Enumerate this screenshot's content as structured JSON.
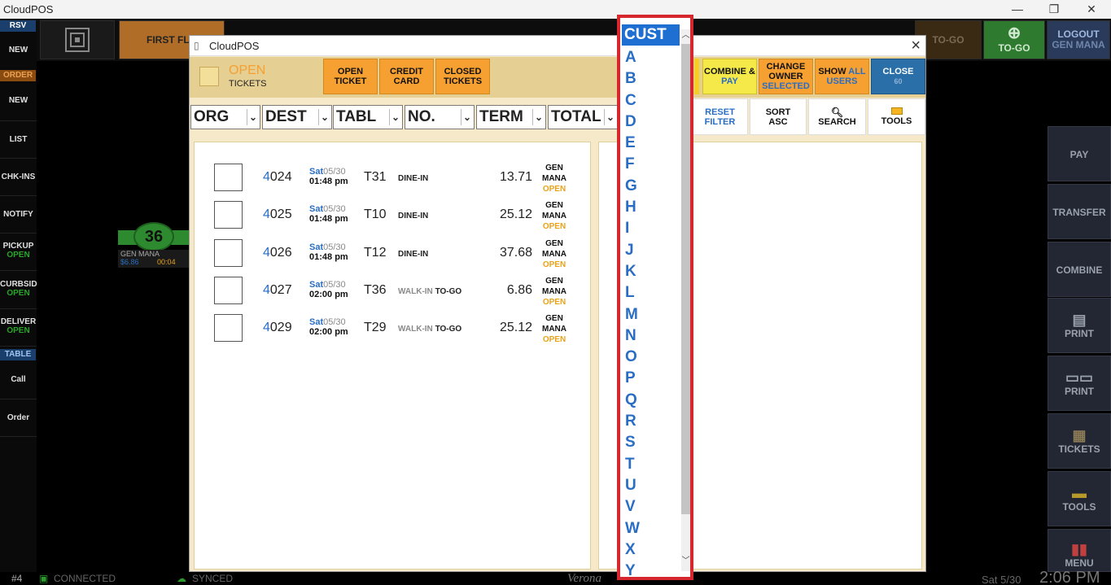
{
  "window": {
    "title": "CloudPOS",
    "min": "—",
    "restore": "❐",
    "close": "✕"
  },
  "leftbar": {
    "sec_rsv": "RSV",
    "new1": "NEW",
    "sec_order": "ORDER",
    "new2": "NEW",
    "list": "LIST",
    "chkins": "CHK-INS",
    "notify": "NOTIFY",
    "pickup": "PICKUP",
    "pickup_status": "OPEN",
    "curbside": "CURBSID",
    "curbside_status": "OPEN",
    "delivery": "DELIVER",
    "delivery_status": "OPEN",
    "sec_table": "TABLE",
    "call": "Call",
    "order": "Order"
  },
  "topbar": {
    "floor": "FIRST FLO",
    "togo1": "TO-GO",
    "togo2": "TO-GO",
    "logout": "LOGOUT",
    "logout_user": "GEN MANA"
  },
  "floorwidget": {
    "table_num": "36",
    "owner": "GEN MANA",
    "amount": "$6.86",
    "time": "00:04"
  },
  "rightpanel": {
    "pay": "PAY",
    "transfer": "TRANSFER",
    "combine": "COMBINE",
    "print1": "PRINT",
    "print2": "PRINT",
    "tickets": "TICKETS",
    "tools": "TOOLS",
    "menu": "MENU"
  },
  "statusbar": {
    "station": "#4",
    "connected": "CONNECTED",
    "synced": "SYNCED",
    "brand": "Verona",
    "date": "Sat 5/30",
    "time": "2:06 PM"
  },
  "dialog": {
    "title": "CloudPOS",
    "status": "OPEN",
    "status_sub": "TICKETS",
    "open_ticket_1": "OPEN",
    "open_ticket_2": "TICKET",
    "credit_card_1": "CREDIT",
    "credit_card_2": "CARD",
    "closed_tickets_1": "CLOSED",
    "closed_tickets_2": "TICKETS",
    "combine_1": "COMBINE &",
    "combine_2": "PAY",
    "change_owner_1": "CHANGE",
    "change_owner_2": "OWNER",
    "change_owner_3": "SELECTED",
    "show_all_1": "SHOW",
    "show_all_2": "ALL",
    "show_all_3": "USERS",
    "close_1": "CLOSE",
    "close_2": "60",
    "filters": {
      "org": "ORG",
      "dest": "DEST",
      "tabl": "TABL",
      "no": "NO.",
      "term": "TERM",
      "total": "TOTAL"
    },
    "reset_1": "RESET",
    "reset_2": "FILTER",
    "sort_1": "SORT",
    "sort_2": "ASC",
    "search": "SEARCH",
    "tools": "TOOLS",
    "tickets": [
      {
        "num_head": "4",
        "num_tail": "024",
        "day": "Sat",
        "md": "05/30",
        "time": "01:48 pm",
        "table": "T31",
        "type_a": "",
        "type_b": "DINE-IN",
        "amount": "13.71",
        "owner1": "GEN",
        "owner2": "MANA",
        "status": "OPEN"
      },
      {
        "num_head": "4",
        "num_tail": "025",
        "day": "Sat",
        "md": "05/30",
        "time": "01:48 pm",
        "table": "T10",
        "type_a": "",
        "type_b": "DINE-IN",
        "amount": "25.12",
        "owner1": "GEN",
        "owner2": "MANA",
        "status": "OPEN"
      },
      {
        "num_head": "4",
        "num_tail": "026",
        "day": "Sat",
        "md": "05/30",
        "time": "01:48 pm",
        "table": "T12",
        "type_a": "",
        "type_b": "DINE-IN",
        "amount": "37.68",
        "owner1": "GEN",
        "owner2": "MANA",
        "status": "OPEN"
      },
      {
        "num_head": "4",
        "num_tail": "027",
        "day": "Sat",
        "md": "05/30",
        "time": "02:00 pm",
        "table": "T36",
        "type_a": "WALK-IN",
        "type_b": "TO-GO",
        "amount": "6.86",
        "owner1": "GEN",
        "owner2": "MANA",
        "status": "OPEN"
      },
      {
        "num_head": "4",
        "num_tail": "029",
        "day": "Sat",
        "md": "05/30",
        "time": "02:00 pm",
        "table": "T29",
        "type_a": "WALK-IN",
        "type_b": "TO-GO",
        "amount": "25.12",
        "owner1": "GEN",
        "owner2": "MANA",
        "status": "OPEN"
      }
    ]
  },
  "cust_dropdown": {
    "selected": "CUST",
    "letters": [
      "A",
      "B",
      "C",
      "D",
      "E",
      "F",
      "G",
      "H",
      "I",
      "J",
      "K",
      "L",
      "M",
      "N",
      "O",
      "P",
      "Q",
      "R",
      "S",
      "T",
      "U",
      "V",
      "W",
      "X",
      "Y"
    ]
  },
  "colors": {
    "accent_blue": "#2a6dc4",
    "orange": "#f5a031",
    "open_status": "#e8a31a",
    "highlight": "#d6262e"
  }
}
